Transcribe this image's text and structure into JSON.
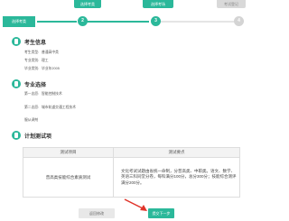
{
  "tabs": [
    "选择考类",
    "选择考场",
    "考试登记"
  ],
  "steps": {
    "first_label": "选择考类",
    "numbers": [
      "2",
      "3",
      "4"
    ]
  },
  "exam_info": {
    "title": "考生信息",
    "fields": [
      {
        "label": "考生类型:",
        "value": "普通高中类"
      },
      {
        "label": "专业类别:",
        "value": "理工"
      },
      {
        "label": "毕业类别:",
        "value": "毕业年2005"
      }
    ]
  },
  "major": {
    "title": "专业选择",
    "fields": [
      {
        "label": "第一志愿:",
        "value": "智能控制技术"
      },
      {
        "label": "第二志愿:",
        "value": "城市轨道交通工程技术"
      },
      {
        "label": "服从调剂",
        "value": ""
      }
    ]
  },
  "plan": {
    "title": "计划测试项",
    "headers": [
      "测试项目",
      "测试要点"
    ],
    "rows": [
      {
        "name": "普高类技能综合素质测试",
        "desc": "文化考试试题由省统一命制，分普高类、中职类。语文、数学、英语三科同堂分卷，每科满分100分，总分300分；技能综合测评满分200分。"
      }
    ]
  },
  "buttons": {
    "prev": "返回修改",
    "next": "提交下一步"
  },
  "colors": {
    "accent": "#2bb89a",
    "arrow": "#e0342a"
  }
}
